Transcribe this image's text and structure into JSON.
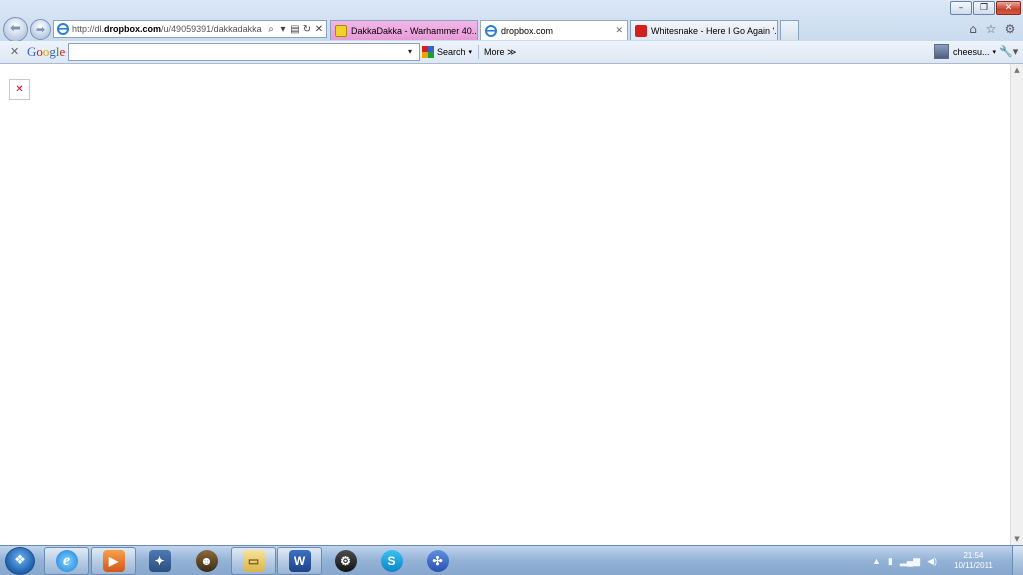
{
  "window": {
    "minimize_glyph": "–",
    "maximize_glyph": "❐",
    "close_glyph": "✕"
  },
  "address_bar": {
    "url_prefix": "http://dl.",
    "url_domain": "dropbox.com",
    "url_rest": "/u/49059391/dakkadakka",
    "icons": {
      "search": "⌕",
      "dropdown": "▾",
      "compat": "▤",
      "refresh": "↻",
      "stop": "✕"
    }
  },
  "tabs": [
    {
      "label": "DakkaDakka - Warhammer 40...",
      "favicon": "dakkadakka-icon",
      "color": "#e79ad8"
    },
    {
      "label": "dropbox.com",
      "favicon": "ie-page-icon",
      "active": true,
      "close": "✕"
    },
    {
      "label": "Whitesnake - Here I Go Again '...",
      "favicon": "youtube-icon"
    }
  ],
  "google_toolbar": {
    "close": "✕",
    "logo": "Google",
    "search_value": "",
    "search_button": "Search",
    "dropdown_arrow": "▾",
    "more": "More ≫",
    "user": "cheesu...",
    "user_arrow": "▾",
    "wrench": "🔧▾"
  },
  "content": {
    "broken_image_glyph": "✕"
  },
  "taskbar": {
    "items": [
      "ie",
      "media-player",
      "app",
      "app",
      "explorer",
      "word",
      "steam",
      "skype",
      "app"
    ],
    "tray": {
      "time": "21:54",
      "date": "10/11/2011"
    }
  },
  "colors": {
    "accent": "#1b5fae",
    "tab_dakka": "#e79ad8",
    "close_button": "#c7412c"
  }
}
